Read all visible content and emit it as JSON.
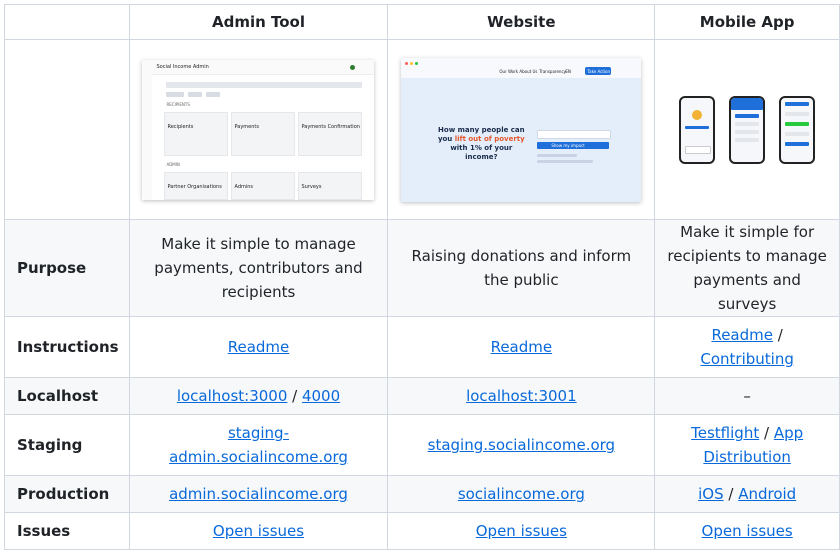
{
  "columns": [
    "Admin Tool",
    "Website",
    "Mobile App"
  ],
  "thumbs": {
    "admin": {
      "app_title": "Social Income Admin",
      "section_recipients": "RECIPIENTS",
      "cards": [
        "Recipients",
        "Payments",
        "Payments Confirmation"
      ],
      "section_admin": "ADMIN",
      "cards2": [
        "Partner Organisations",
        "Admins",
        "Surveys"
      ]
    },
    "website": {
      "headline_pre": "How many people can you ",
      "headline_accent": "lift out of poverty",
      "headline_post": " with 1% of your income?",
      "button": "Show my impact",
      "nav": [
        "Our Work",
        "About Us",
        "Transparency",
        "EN"
      ],
      "cta": "Take Action"
    },
    "mobile": {
      "phone_count": 3
    }
  },
  "rows": [
    {
      "label": "Purpose",
      "cells": [
        {
          "text": "Make it simple to manage payments, contributors and recipients"
        },
        {
          "text": "Raising donations and inform the public"
        },
        {
          "text": "Make it simple for recipients to manage payments and surveys"
        }
      ]
    },
    {
      "label": "Instructions",
      "cells": [
        {
          "links": [
            "Readme"
          ]
        },
        {
          "links": [
            "Readme"
          ]
        },
        {
          "links": [
            "Readme",
            "Contributing"
          ]
        }
      ]
    },
    {
      "label": "Localhost",
      "cells": [
        {
          "links": [
            "localhost:3000",
            "4000"
          ]
        },
        {
          "links": [
            "localhost:3001"
          ]
        },
        {
          "text": "–"
        }
      ]
    },
    {
      "label": "Staging",
      "cells": [
        {
          "links": [
            "staging-admin.socialincome.org"
          ]
        },
        {
          "links": [
            "staging.socialincome.org"
          ]
        },
        {
          "links": [
            "Testflight",
            "App Distribution"
          ]
        }
      ]
    },
    {
      "label": "Production",
      "cells": [
        {
          "links": [
            "admin.socialincome.org"
          ]
        },
        {
          "links": [
            "socialincome.org"
          ]
        },
        {
          "links": [
            "iOS",
            "Android"
          ]
        }
      ]
    },
    {
      "label": "Issues",
      "cells": [
        {
          "links": [
            "Open issues"
          ]
        },
        {
          "links": [
            "Open issues"
          ]
        },
        {
          "links": [
            "Open issues"
          ]
        }
      ]
    }
  ],
  "separator": " / ",
  "colors": {
    "link": "#0969da",
    "border": "#d0d7de",
    "alt_row": "#f6f8fa",
    "accent_orange": "#e4572e",
    "brand_blue": "#1e6fd9"
  }
}
